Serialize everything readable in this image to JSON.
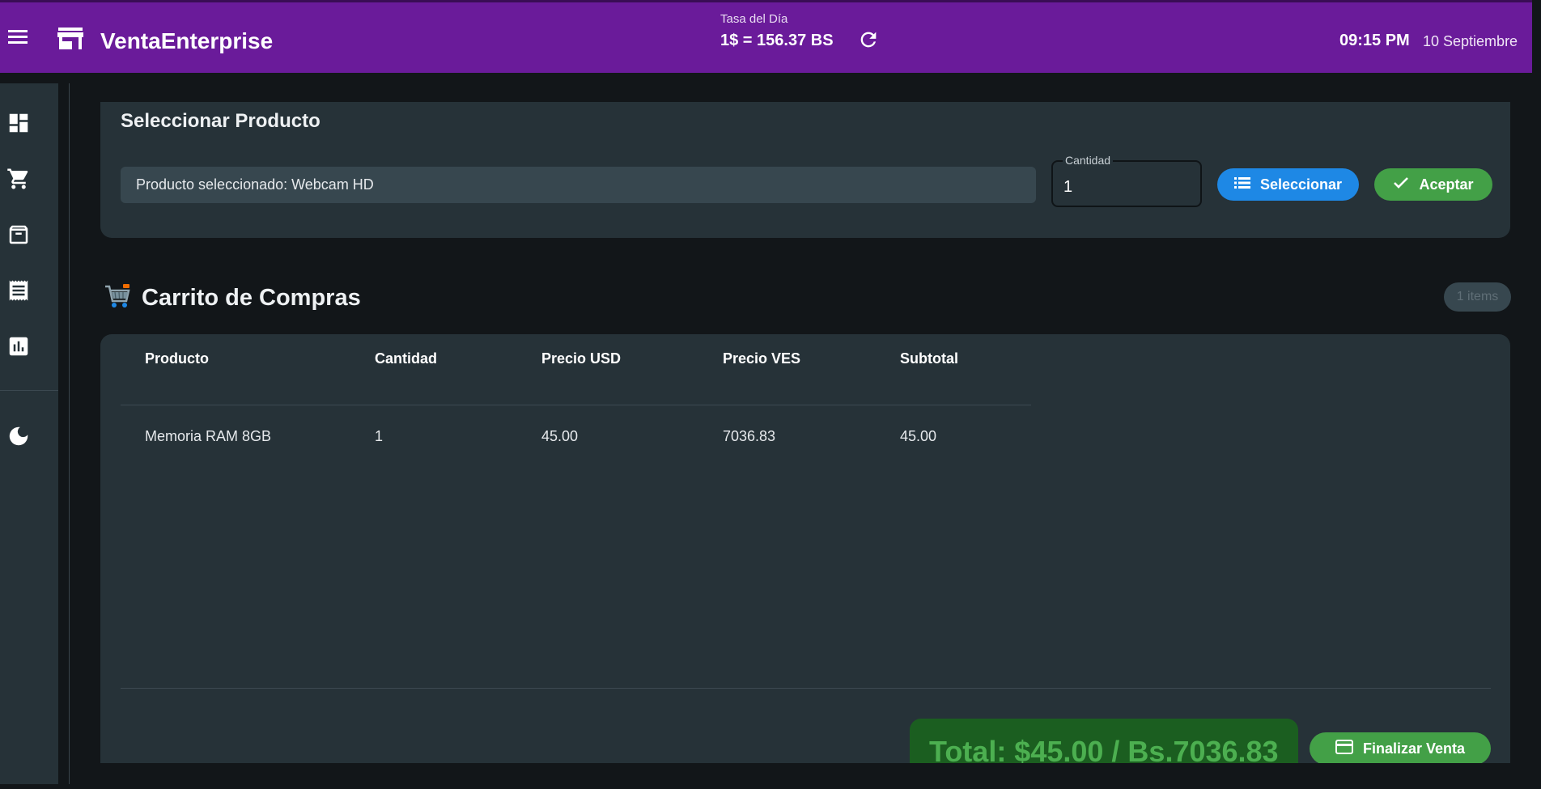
{
  "header": {
    "app_title": "VentaEnterprise",
    "rate_label": "Tasa del Día",
    "rate_value": "1$ = 156.37 BS",
    "time": "09:15 PM",
    "date": "10 Septiembre",
    "bg_color": "#6a1b9a"
  },
  "sidebar": {
    "items": [
      {
        "icon": "dashboard-icon"
      },
      {
        "icon": "cart-icon"
      },
      {
        "icon": "inventory-icon"
      },
      {
        "icon": "receipt-icon"
      },
      {
        "icon": "reports-icon"
      }
    ],
    "theme_toggle_icon": "moon-icon"
  },
  "select_product": {
    "title": "Seleccionar Producto",
    "product_field_value": "Producto seleccionado: Webcam HD",
    "quantity_label": "Cantidad",
    "quantity_value": "1",
    "select_button": "Seleccionar",
    "accept_button": "Aceptar"
  },
  "cart": {
    "title": "Carrito de Compras",
    "items_badge": "1 items",
    "columns": [
      "Producto",
      "Cantidad",
      "Precio USD",
      "Precio VES",
      "Subtotal"
    ],
    "rows": [
      [
        "Memoria RAM 8GB",
        "1",
        "45.00",
        "7036.83",
        "45.00"
      ]
    ],
    "total_text": "Total: $45.00 / Bs.7036.83",
    "finish_button": "Finalizar Venta"
  },
  "colors": {
    "primary": "#6a1b9a",
    "blue": "#1e88e5",
    "green": "#43a047",
    "total_bg": "#1b5e20",
    "total_text": "#4caf50"
  }
}
